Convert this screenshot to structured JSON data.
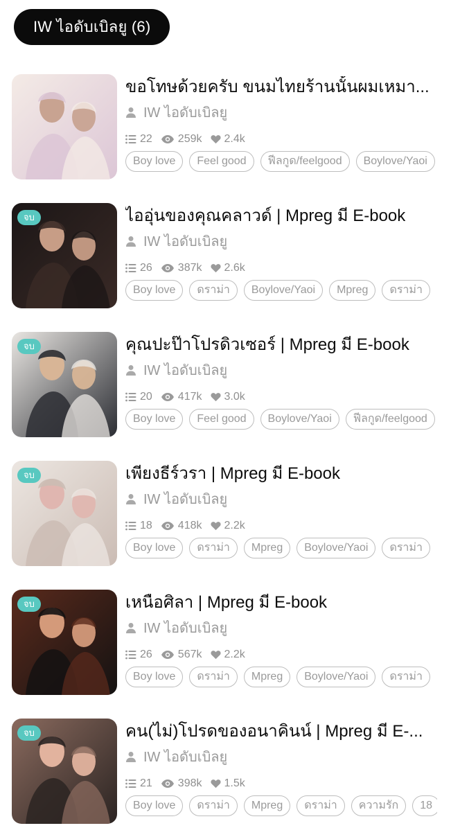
{
  "header": {
    "label": "IW ไอดับเบิลยู (6)"
  },
  "books": [
    {
      "title": "ขอโทษด้วยครับ ขนมไทยร้านนั้นผมเหมา...",
      "author": "IW ไอดับเบิลยู",
      "chapters": "22",
      "views": "259k",
      "likes": "2.4k",
      "badge": "",
      "tags": [
        "Boy love",
        "Feel good",
        "ฟีลกูด/feelgood",
        "Boylove/Yaoi"
      ],
      "cover_colors": [
        "#f4ebe6",
        "#dcc6d6",
        "#c8a391"
      ]
    },
    {
      "title": "ไออุ่นของคุณคลาวด์ | Mpreg มี E-book",
      "author": "IW ไอดับเบิลยู",
      "chapters": "26",
      "views": "387k",
      "likes": "2.6k",
      "badge": "จบ",
      "tags": [
        "Boy love",
        "ดราม่า",
        "Boylove/Yaoi",
        "Mpreg",
        "ดราม่า"
      ],
      "cover_colors": [
        "#1b1616",
        "#3a2a26",
        "#c79d86"
      ]
    },
    {
      "title": "คุณปะป๊าโปรดิวเซอร์ | Mpreg มี E-book",
      "author": "IW ไอดับเบิลยู",
      "chapters": "20",
      "views": "417k",
      "likes": "3.0k",
      "badge": "จบ",
      "tags": [
        "Boy love",
        "Feel good",
        "Boylove/Yaoi",
        "ฟีลกูด/feelgood"
      ],
      "cover_colors": [
        "#e9e6e2",
        "#2b2d33",
        "#d8b596"
      ]
    },
    {
      "title": "เพียงธีร์วรา | Mpreg มี E-book",
      "author": "IW ไอดับเบิลยู",
      "chapters": "18",
      "views": "418k",
      "likes": "2.2k",
      "badge": "จบ",
      "tags": [
        "Boy love",
        "ดราม่า",
        "Mpreg",
        "Boylove/Yaoi",
        "ดราม่า"
      ],
      "cover_colors": [
        "#ece6e1",
        "#cbbcb4",
        "#e0b6b0"
      ]
    },
    {
      "title": "เหนือศิลา | Mpreg มี E-book",
      "author": "IW ไอดับเบิลยู",
      "chapters": "26",
      "views": "567k",
      "likes": "2.2k",
      "badge": "จบ",
      "tags": [
        "Boy love",
        "ดราม่า",
        "Mpreg",
        "Boylove/Yaoi",
        "ดราม่า"
      ],
      "cover_colors": [
        "#5a2a1c",
        "#141212",
        "#d49a7a"
      ]
    },
    {
      "title": "คน(ไม่)โปรดของอนาคินน์ | Mpreg มี E-...",
      "author": "IW ไอดับเบิลยู",
      "chapters": "21",
      "views": "398k",
      "likes": "1.5k",
      "badge": "จบ",
      "tags": [
        "Boy love",
        "ดราม่า",
        "Mpreg",
        "ดราม่า",
        "ความรัก",
        "18"
      ],
      "cover_colors": [
        "#8a6a5e",
        "#2b2422",
        "#e2b39e"
      ]
    }
  ],
  "icons": {
    "author": "person-icon",
    "chapters": "list-icon",
    "views": "eye-icon",
    "likes": "heart-icon"
  }
}
